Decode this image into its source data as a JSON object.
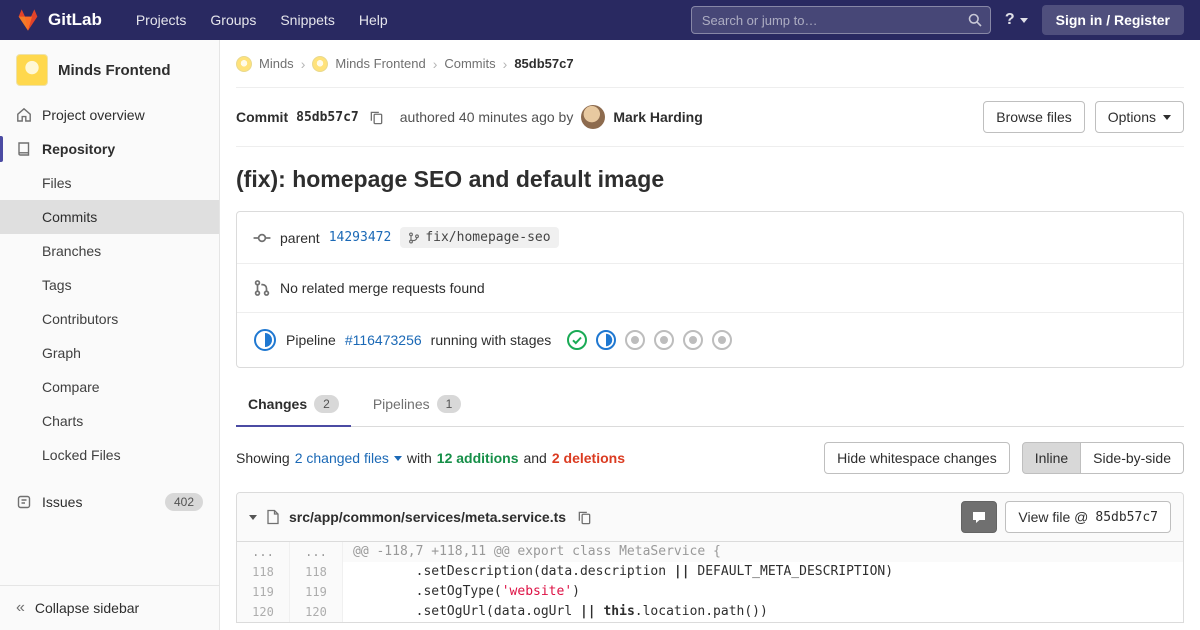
{
  "colors": {
    "navbar-bg": "#292961",
    "link": "#1b69b6",
    "success": "#168f48",
    "danger": "#db3b21",
    "running": "#1f78d1",
    "indicator": "#4b4ba3"
  },
  "navbar": {
    "logo_text": "GitLab",
    "menu": [
      "Projects",
      "Groups",
      "Snippets",
      "Help"
    ],
    "search_placeholder": "Search or jump to…",
    "help_label": "?",
    "signin_label": "Sign in / Register"
  },
  "sidebar": {
    "project_name": "Minds Frontend",
    "overview_label": "Project overview",
    "repository_label": "Repository",
    "repo_items": [
      "Files",
      "Commits",
      "Branches",
      "Tags",
      "Contributors",
      "Graph",
      "Compare",
      "Charts",
      "Locked Files"
    ],
    "active_repo_item": "Commits",
    "issues_label": "Issues",
    "issues_count": "402",
    "collapse_label": "Collapse sidebar",
    "collapse_glyph": "«"
  },
  "breadcrumb": {
    "separator": "›",
    "items": [
      "Minds",
      "Minds Frontend",
      "Commits"
    ],
    "current": "85db57c7"
  },
  "commit": {
    "label": "Commit",
    "sha": "85db57c7",
    "authored": "authored 40 minutes ago by",
    "author": "Mark Harding",
    "browse_files": "Browse files",
    "options": "Options",
    "title": "(fix): homepage SEO and default image",
    "parent_label": "parent",
    "parent_sha": "14293472",
    "branch": "fix/homepage-seo",
    "no_mr_text": "No related merge requests found",
    "pipeline_label": "Pipeline",
    "pipeline_id": "#116473256",
    "pipeline_status": "running with stages",
    "pipeline_stages": [
      "success",
      "running",
      "created",
      "created",
      "created",
      "created"
    ]
  },
  "tabs": {
    "changes": "Changes",
    "changes_count": "2",
    "pipelines": "Pipelines",
    "pipelines_count": "1"
  },
  "summary": {
    "showing": "Showing",
    "files_link": "2 changed files",
    "with_text": "with",
    "additions": "12 additions",
    "and_text": "and",
    "deletions": "2 deletions",
    "hide_whitespace": "Hide whitespace changes",
    "inline": "Inline",
    "side_by_side": "Side-by-side"
  },
  "diff": {
    "file_path": "src/app/common/services/meta.service.ts",
    "view_file_prefix": "View file @",
    "view_file_sha": "85db57c7",
    "lines": [
      {
        "old": "...",
        "new": "...",
        "hunk": true,
        "segs": [
          [
            "@@ -118,7 +118,11 @@ export class MetaService {",
            "h"
          ]
        ]
      },
      {
        "old": "118",
        "new": "118",
        "hunk": false,
        "segs": [
          [
            "        .setDescription(data.description ",
            ""
          ],
          [
            "||",
            "b"
          ],
          [
            " DEFAULT_META_DESCRIPTION)",
            ""
          ]
        ]
      },
      {
        "old": "119",
        "new": "119",
        "hunk": false,
        "segs": [
          [
            "        .setOgType(",
            ""
          ],
          [
            "'website'",
            "s"
          ],
          [
            ")",
            ""
          ]
        ]
      },
      {
        "old": "120",
        "new": "120",
        "hunk": false,
        "segs": [
          [
            "        .setOgUrl(data.ogUrl ",
            ""
          ],
          [
            "||",
            "b"
          ],
          [
            " ",
            ""
          ],
          [
            "this",
            "b"
          ],
          [
            ".location.path())",
            ""
          ]
        ]
      }
    ]
  }
}
